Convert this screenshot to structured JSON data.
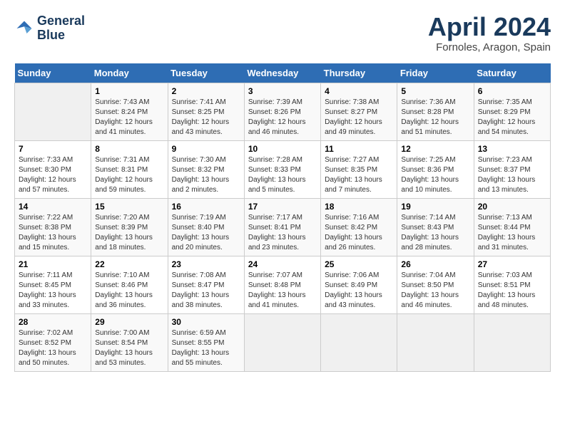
{
  "header": {
    "logo_line1": "General",
    "logo_line2": "Blue",
    "title": "April 2024",
    "subtitle": "Fornoles, Aragon, Spain"
  },
  "weekdays": [
    "Sunday",
    "Monday",
    "Tuesday",
    "Wednesday",
    "Thursday",
    "Friday",
    "Saturday"
  ],
  "weeks": [
    [
      {
        "day": "",
        "sunrise": "",
        "sunset": "",
        "daylight": ""
      },
      {
        "day": "1",
        "sunrise": "Sunrise: 7:43 AM",
        "sunset": "Sunset: 8:24 PM",
        "daylight": "Daylight: 12 hours and 41 minutes."
      },
      {
        "day": "2",
        "sunrise": "Sunrise: 7:41 AM",
        "sunset": "Sunset: 8:25 PM",
        "daylight": "Daylight: 12 hours and 43 minutes."
      },
      {
        "day": "3",
        "sunrise": "Sunrise: 7:39 AM",
        "sunset": "Sunset: 8:26 PM",
        "daylight": "Daylight: 12 hours and 46 minutes."
      },
      {
        "day": "4",
        "sunrise": "Sunrise: 7:38 AM",
        "sunset": "Sunset: 8:27 PM",
        "daylight": "Daylight: 12 hours and 49 minutes."
      },
      {
        "day": "5",
        "sunrise": "Sunrise: 7:36 AM",
        "sunset": "Sunset: 8:28 PM",
        "daylight": "Daylight: 12 hours and 51 minutes."
      },
      {
        "day": "6",
        "sunrise": "Sunrise: 7:35 AM",
        "sunset": "Sunset: 8:29 PM",
        "daylight": "Daylight: 12 hours and 54 minutes."
      }
    ],
    [
      {
        "day": "7",
        "sunrise": "Sunrise: 7:33 AM",
        "sunset": "Sunset: 8:30 PM",
        "daylight": "Daylight: 12 hours and 57 minutes."
      },
      {
        "day": "8",
        "sunrise": "Sunrise: 7:31 AM",
        "sunset": "Sunset: 8:31 PM",
        "daylight": "Daylight: 12 hours and 59 minutes."
      },
      {
        "day": "9",
        "sunrise": "Sunrise: 7:30 AM",
        "sunset": "Sunset: 8:32 PM",
        "daylight": "Daylight: 13 hours and 2 minutes."
      },
      {
        "day": "10",
        "sunrise": "Sunrise: 7:28 AM",
        "sunset": "Sunset: 8:33 PM",
        "daylight": "Daylight: 13 hours and 5 minutes."
      },
      {
        "day": "11",
        "sunrise": "Sunrise: 7:27 AM",
        "sunset": "Sunset: 8:35 PM",
        "daylight": "Daylight: 13 hours and 7 minutes."
      },
      {
        "day": "12",
        "sunrise": "Sunrise: 7:25 AM",
        "sunset": "Sunset: 8:36 PM",
        "daylight": "Daylight: 13 hours and 10 minutes."
      },
      {
        "day": "13",
        "sunrise": "Sunrise: 7:23 AM",
        "sunset": "Sunset: 8:37 PM",
        "daylight": "Daylight: 13 hours and 13 minutes."
      }
    ],
    [
      {
        "day": "14",
        "sunrise": "Sunrise: 7:22 AM",
        "sunset": "Sunset: 8:38 PM",
        "daylight": "Daylight: 13 hours and 15 minutes."
      },
      {
        "day": "15",
        "sunrise": "Sunrise: 7:20 AM",
        "sunset": "Sunset: 8:39 PM",
        "daylight": "Daylight: 13 hours and 18 minutes."
      },
      {
        "day": "16",
        "sunrise": "Sunrise: 7:19 AM",
        "sunset": "Sunset: 8:40 PM",
        "daylight": "Daylight: 13 hours and 20 minutes."
      },
      {
        "day": "17",
        "sunrise": "Sunrise: 7:17 AM",
        "sunset": "Sunset: 8:41 PM",
        "daylight": "Daylight: 13 hours and 23 minutes."
      },
      {
        "day": "18",
        "sunrise": "Sunrise: 7:16 AM",
        "sunset": "Sunset: 8:42 PM",
        "daylight": "Daylight: 13 hours and 26 minutes."
      },
      {
        "day": "19",
        "sunrise": "Sunrise: 7:14 AM",
        "sunset": "Sunset: 8:43 PM",
        "daylight": "Daylight: 13 hours and 28 minutes."
      },
      {
        "day": "20",
        "sunrise": "Sunrise: 7:13 AM",
        "sunset": "Sunset: 8:44 PM",
        "daylight": "Daylight: 13 hours and 31 minutes."
      }
    ],
    [
      {
        "day": "21",
        "sunrise": "Sunrise: 7:11 AM",
        "sunset": "Sunset: 8:45 PM",
        "daylight": "Daylight: 13 hours and 33 minutes."
      },
      {
        "day": "22",
        "sunrise": "Sunrise: 7:10 AM",
        "sunset": "Sunset: 8:46 PM",
        "daylight": "Daylight: 13 hours and 36 minutes."
      },
      {
        "day": "23",
        "sunrise": "Sunrise: 7:08 AM",
        "sunset": "Sunset: 8:47 PM",
        "daylight": "Daylight: 13 hours and 38 minutes."
      },
      {
        "day": "24",
        "sunrise": "Sunrise: 7:07 AM",
        "sunset": "Sunset: 8:48 PM",
        "daylight": "Daylight: 13 hours and 41 minutes."
      },
      {
        "day": "25",
        "sunrise": "Sunrise: 7:06 AM",
        "sunset": "Sunset: 8:49 PM",
        "daylight": "Daylight: 13 hours and 43 minutes."
      },
      {
        "day": "26",
        "sunrise": "Sunrise: 7:04 AM",
        "sunset": "Sunset: 8:50 PM",
        "daylight": "Daylight: 13 hours and 46 minutes."
      },
      {
        "day": "27",
        "sunrise": "Sunrise: 7:03 AM",
        "sunset": "Sunset: 8:51 PM",
        "daylight": "Daylight: 13 hours and 48 minutes."
      }
    ],
    [
      {
        "day": "28",
        "sunrise": "Sunrise: 7:02 AM",
        "sunset": "Sunset: 8:52 PM",
        "daylight": "Daylight: 13 hours and 50 minutes."
      },
      {
        "day": "29",
        "sunrise": "Sunrise: 7:00 AM",
        "sunset": "Sunset: 8:54 PM",
        "daylight": "Daylight: 13 hours and 53 minutes."
      },
      {
        "day": "30",
        "sunrise": "Sunrise: 6:59 AM",
        "sunset": "Sunset: 8:55 PM",
        "daylight": "Daylight: 13 hours and 55 minutes."
      },
      {
        "day": "",
        "sunrise": "",
        "sunset": "",
        "daylight": ""
      },
      {
        "day": "",
        "sunrise": "",
        "sunset": "",
        "daylight": ""
      },
      {
        "day": "",
        "sunrise": "",
        "sunset": "",
        "daylight": ""
      },
      {
        "day": "",
        "sunrise": "",
        "sunset": "",
        "daylight": ""
      }
    ]
  ]
}
